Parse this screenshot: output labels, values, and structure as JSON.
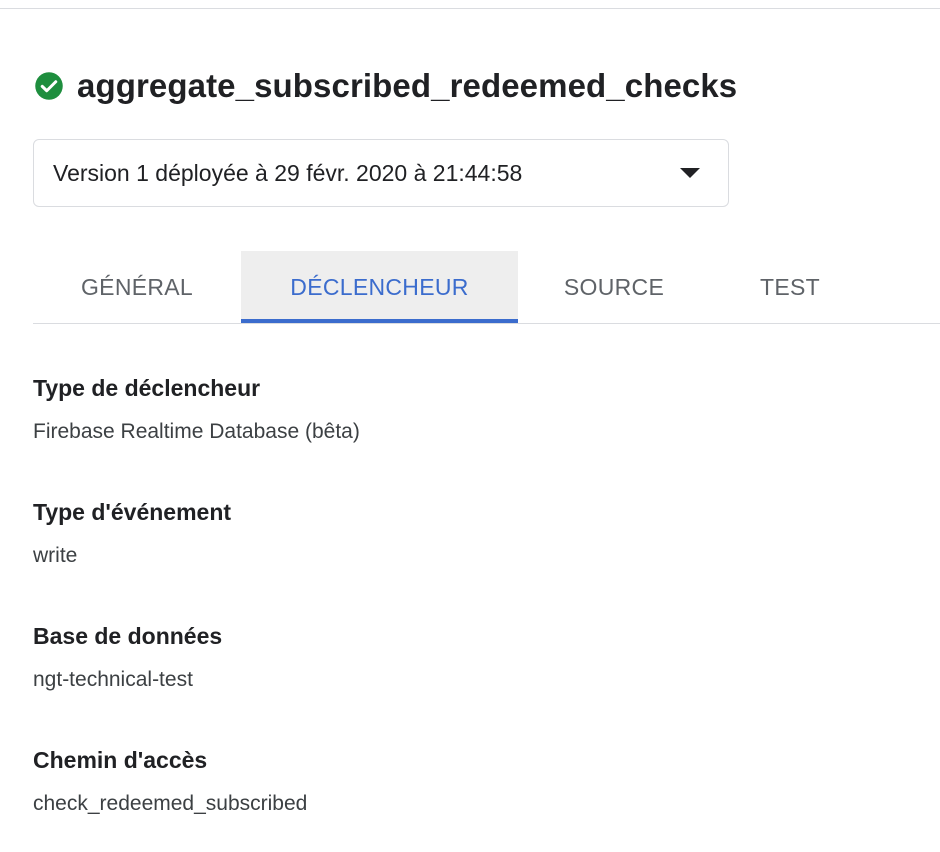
{
  "function": {
    "name": "aggregate_subscribed_redeemed_checks",
    "status_icon": "check-circle-icon",
    "status_color": "#1e8e3e"
  },
  "version_select": {
    "value": "Version 1 déployée à 29 févr. 2020 à 21:44:58",
    "arrow_icon": "dropdown-arrow-icon"
  },
  "tabs": [
    {
      "label": "GÉNÉRAL",
      "active": false
    },
    {
      "label": "DÉCLENCHEUR",
      "active": true
    },
    {
      "label": "SOURCE",
      "active": false
    },
    {
      "label": "TEST",
      "active": false
    }
  ],
  "accent_color": "#3b6ccd",
  "trigger_details": {
    "trigger_type": {
      "label": "Type de déclencheur",
      "value": "Firebase Realtime Database (bêta)"
    },
    "event_type": {
      "label": "Type d'événement",
      "value": "write"
    },
    "database": {
      "label": "Base de données",
      "value": "ngt-technical-test"
    },
    "path": {
      "label": "Chemin d'accès",
      "value": "check_redeemed_subscribed"
    }
  }
}
